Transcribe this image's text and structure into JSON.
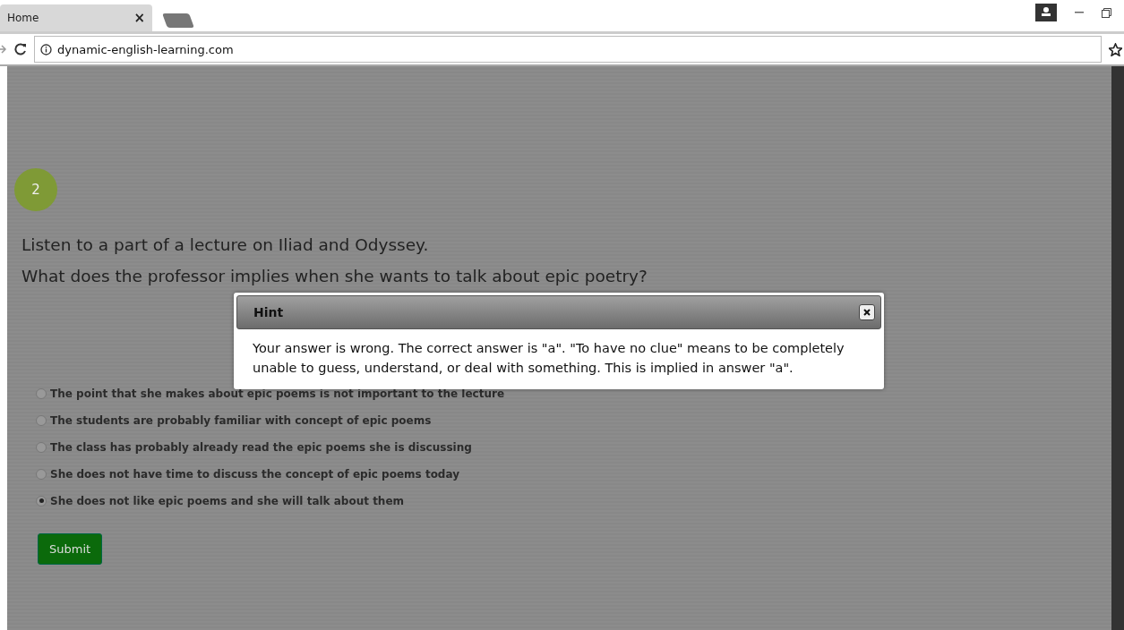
{
  "browser": {
    "tabs": [
      {
        "label": "Home",
        "close": "×",
        "selected": true
      }
    ],
    "address": "dynamic-english-learning.com"
  },
  "question": {
    "number": "2",
    "lines": [
      "Listen to a part of a lecture on Iliad and Odyssey.",
      "What does the professor implies when she wants to talk about epic poetry?"
    ]
  },
  "options": [
    {
      "label": "The point that she makes about epic poems is not important to the lecture",
      "selected": false
    },
    {
      "label": "The students are probably familiar with concept of epic poems",
      "selected": false
    },
    {
      "label": "The class has probably already read the epic poems she is discussing",
      "selected": false
    },
    {
      "label": "She does not have time to discuss the concept of epic poems today",
      "selected": false
    },
    {
      "label": "She does not like epic poems and she will talk about them",
      "selected": true
    }
  ],
  "submit": "Submit",
  "dialog": {
    "title": "Hint",
    "message": "Your answer is wrong. The correct answer is \"a\". \"To have no clue\" means to be completely unable to guess, understand, or deal with something. This is implied in answer \"a\"."
  }
}
